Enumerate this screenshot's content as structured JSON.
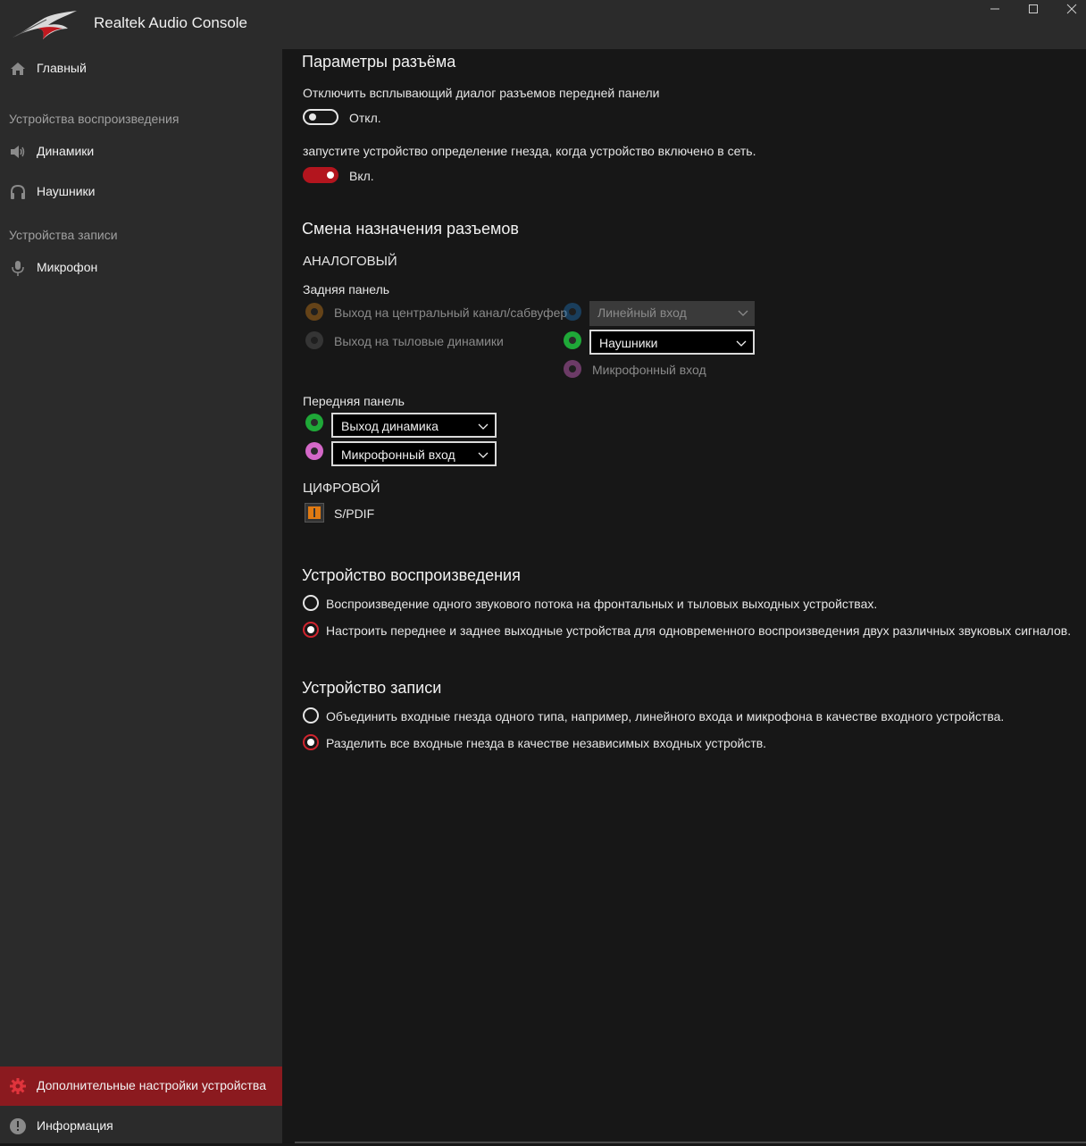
{
  "window": {
    "title": "Realtek Audio Console",
    "controls": [
      "minimize",
      "maximize",
      "close"
    ]
  },
  "sidebar": {
    "home": {
      "label": "Главный",
      "icon": "home-icon"
    },
    "playback_section": "Устройства воспроизведения",
    "speakers": {
      "label": "Динамики",
      "icon": "speaker-icon"
    },
    "headphones": {
      "label": "Наушники",
      "icon": "headphones-icon"
    },
    "recording_section": "Устройства записи",
    "microphone": {
      "label": "Микрофон",
      "icon": "microphone-icon"
    },
    "advanced": {
      "label": "Дополнительные настройки устройства",
      "icon": "gear-icon",
      "active": true
    },
    "info": {
      "label": "Информация",
      "icon": "info-icon"
    }
  },
  "connector_settings": {
    "title": "Параметры разъёма",
    "popup_label": "Отключить всплывающий диалог разъемов передней панели",
    "popup_state": "Откл.",
    "detect_label": "запустите устройство определение гнезда, когда  устройство включено в сеть.",
    "detect_state": "Вкл."
  },
  "jack_retasking": {
    "title": "Смена назначения разъемов",
    "analog": "АНАЛОГОВЫЙ",
    "rear_panel": "Задняя панель",
    "rear_center_sub": "Выход на центральный канал/сабвуфер",
    "rear_surround": "Выход на тыловые динамики",
    "rear_line_in": "Линейный вход",
    "rear_headphones": "Наушники",
    "rear_mic_in": "Микрофонный вход",
    "front_panel": "Передняя панель",
    "front_speaker_out": "Выход динамика",
    "front_mic_in": "Микрофонный вход",
    "digital": "ЦИФРОВОЙ",
    "spdif": "S/PDIF"
  },
  "playback_device": {
    "title": "Устройство воспроизведения",
    "option1": "Воспроизведение одного звукового потока на фронтальных и тыловых выходных устройствах.",
    "option2": "Настроить переднее и заднее выходные устройства для одновременного воспроизведения двух различных звуковых сигналов.",
    "selected": 2
  },
  "recording_device": {
    "title": "Устройство записи",
    "option1": "Объединить входные гнезда одного типа, например, линейного входа и микрофона в качестве входного устройства.",
    "option2": "Разделить все входные гнезда в качестве независимых входных устройств.",
    "selected": 2
  },
  "colors": {
    "accent": "#b3151e",
    "active_nav": "#8b1a1f",
    "jack_orange": "#c47a1a",
    "jack_black": "#5a5a5a",
    "jack_blue": "#1f6fb0",
    "jack_green": "#1fa838",
    "jack_pink": "#d468c8"
  }
}
